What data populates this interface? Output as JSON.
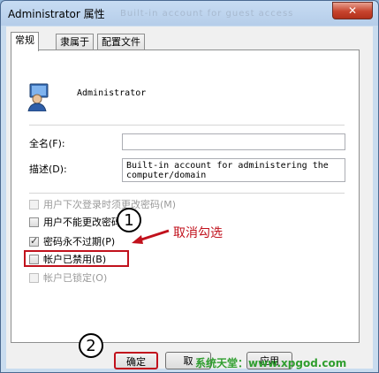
{
  "window": {
    "title": "Administrator 属性",
    "ghost_text": "Built-in account for guest access",
    "close_symbol": "✕"
  },
  "tabs": [
    {
      "label": "常规",
      "active": true
    },
    {
      "label": "隶属于",
      "active": false
    },
    {
      "label": "配置文件",
      "active": false
    }
  ],
  "user": {
    "name": "Administrator"
  },
  "fields": {
    "fullname_label": "全名(F):",
    "fullname_value": "",
    "description_label": "描述(D):",
    "description_line1": "Built-in account for administering the",
    "description_line2": "computer/domain"
  },
  "checkboxes": [
    {
      "label": "用户下次登录时须更改密码(M)",
      "checked": false,
      "disabled": true
    },
    {
      "label": "用户不能更改密码(C)",
      "checked": false,
      "disabled": false
    },
    {
      "label": "密码永不过期(P)",
      "checked": true,
      "disabled": false
    },
    {
      "label": "帐户已禁用(B)",
      "checked": false,
      "disabled": false
    },
    {
      "label": "帐户已锁定(O)",
      "checked": false,
      "disabled": true
    }
  ],
  "annotations": {
    "step1": "1",
    "step2": "2",
    "hint": "取消勾选",
    "accent_color": "#c1111c"
  },
  "buttons": {
    "ok": "确定",
    "cancel": "取",
    "apply": "应用"
  },
  "watermark": "系统天堂：www.xpgod.com"
}
